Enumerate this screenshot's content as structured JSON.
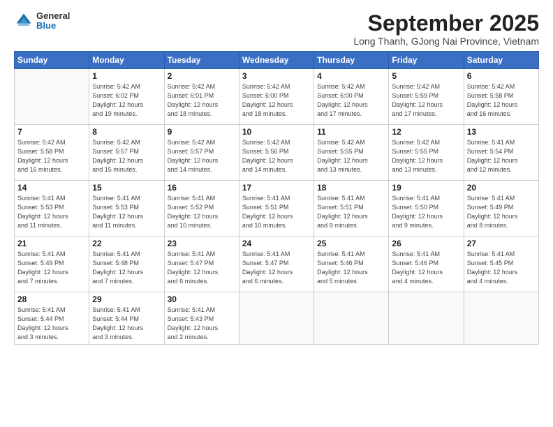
{
  "logo": {
    "general": "General",
    "blue": "Blue"
  },
  "title": "September 2025",
  "subtitle": "Long Thanh, GJong Nai Province, Vietnam",
  "headers": [
    "Sunday",
    "Monday",
    "Tuesday",
    "Wednesday",
    "Thursday",
    "Friday",
    "Saturday"
  ],
  "weeks": [
    [
      {
        "day": "",
        "info": ""
      },
      {
        "day": "1",
        "info": "Sunrise: 5:42 AM\nSunset: 6:02 PM\nDaylight: 12 hours\nand 19 minutes."
      },
      {
        "day": "2",
        "info": "Sunrise: 5:42 AM\nSunset: 6:01 PM\nDaylight: 12 hours\nand 18 minutes."
      },
      {
        "day": "3",
        "info": "Sunrise: 5:42 AM\nSunset: 6:00 PM\nDaylight: 12 hours\nand 18 minutes."
      },
      {
        "day": "4",
        "info": "Sunrise: 5:42 AM\nSunset: 6:00 PM\nDaylight: 12 hours\nand 17 minutes."
      },
      {
        "day": "5",
        "info": "Sunrise: 5:42 AM\nSunset: 5:59 PM\nDaylight: 12 hours\nand 17 minutes."
      },
      {
        "day": "6",
        "info": "Sunrise: 5:42 AM\nSunset: 5:58 PM\nDaylight: 12 hours\nand 16 minutes."
      }
    ],
    [
      {
        "day": "7",
        "info": "Sunrise: 5:42 AM\nSunset: 5:58 PM\nDaylight: 12 hours\nand 16 minutes."
      },
      {
        "day": "8",
        "info": "Sunrise: 5:42 AM\nSunset: 5:57 PM\nDaylight: 12 hours\nand 15 minutes."
      },
      {
        "day": "9",
        "info": "Sunrise: 5:42 AM\nSunset: 5:57 PM\nDaylight: 12 hours\nand 14 minutes."
      },
      {
        "day": "10",
        "info": "Sunrise: 5:42 AM\nSunset: 5:56 PM\nDaylight: 12 hours\nand 14 minutes."
      },
      {
        "day": "11",
        "info": "Sunrise: 5:42 AM\nSunset: 5:55 PM\nDaylight: 12 hours\nand 13 minutes."
      },
      {
        "day": "12",
        "info": "Sunrise: 5:42 AM\nSunset: 5:55 PM\nDaylight: 12 hours\nand 13 minutes."
      },
      {
        "day": "13",
        "info": "Sunrise: 5:41 AM\nSunset: 5:54 PM\nDaylight: 12 hours\nand 12 minutes."
      }
    ],
    [
      {
        "day": "14",
        "info": "Sunrise: 5:41 AM\nSunset: 5:53 PM\nDaylight: 12 hours\nand 11 minutes."
      },
      {
        "day": "15",
        "info": "Sunrise: 5:41 AM\nSunset: 5:53 PM\nDaylight: 12 hours\nand 11 minutes."
      },
      {
        "day": "16",
        "info": "Sunrise: 5:41 AM\nSunset: 5:52 PM\nDaylight: 12 hours\nand 10 minutes."
      },
      {
        "day": "17",
        "info": "Sunrise: 5:41 AM\nSunset: 5:51 PM\nDaylight: 12 hours\nand 10 minutes."
      },
      {
        "day": "18",
        "info": "Sunrise: 5:41 AM\nSunset: 5:51 PM\nDaylight: 12 hours\nand 9 minutes."
      },
      {
        "day": "19",
        "info": "Sunrise: 5:41 AM\nSunset: 5:50 PM\nDaylight: 12 hours\nand 9 minutes."
      },
      {
        "day": "20",
        "info": "Sunrise: 5:41 AM\nSunset: 5:49 PM\nDaylight: 12 hours\nand 8 minutes."
      }
    ],
    [
      {
        "day": "21",
        "info": "Sunrise: 5:41 AM\nSunset: 5:49 PM\nDaylight: 12 hours\nand 7 minutes."
      },
      {
        "day": "22",
        "info": "Sunrise: 5:41 AM\nSunset: 5:48 PM\nDaylight: 12 hours\nand 7 minutes."
      },
      {
        "day": "23",
        "info": "Sunrise: 5:41 AM\nSunset: 5:47 PM\nDaylight: 12 hours\nand 6 minutes."
      },
      {
        "day": "24",
        "info": "Sunrise: 5:41 AM\nSunset: 5:47 PM\nDaylight: 12 hours\nand 6 minutes."
      },
      {
        "day": "25",
        "info": "Sunrise: 5:41 AM\nSunset: 5:46 PM\nDaylight: 12 hours\nand 5 minutes."
      },
      {
        "day": "26",
        "info": "Sunrise: 5:41 AM\nSunset: 5:46 PM\nDaylight: 12 hours\nand 4 minutes."
      },
      {
        "day": "27",
        "info": "Sunrise: 5:41 AM\nSunset: 5:45 PM\nDaylight: 12 hours\nand 4 minutes."
      }
    ],
    [
      {
        "day": "28",
        "info": "Sunrise: 5:41 AM\nSunset: 5:44 PM\nDaylight: 12 hours\nand 3 minutes."
      },
      {
        "day": "29",
        "info": "Sunrise: 5:41 AM\nSunset: 5:44 PM\nDaylight: 12 hours\nand 3 minutes."
      },
      {
        "day": "30",
        "info": "Sunrise: 5:41 AM\nSunset: 5:43 PM\nDaylight: 12 hours\nand 2 minutes."
      },
      {
        "day": "",
        "info": ""
      },
      {
        "day": "",
        "info": ""
      },
      {
        "day": "",
        "info": ""
      },
      {
        "day": "",
        "info": ""
      }
    ]
  ]
}
